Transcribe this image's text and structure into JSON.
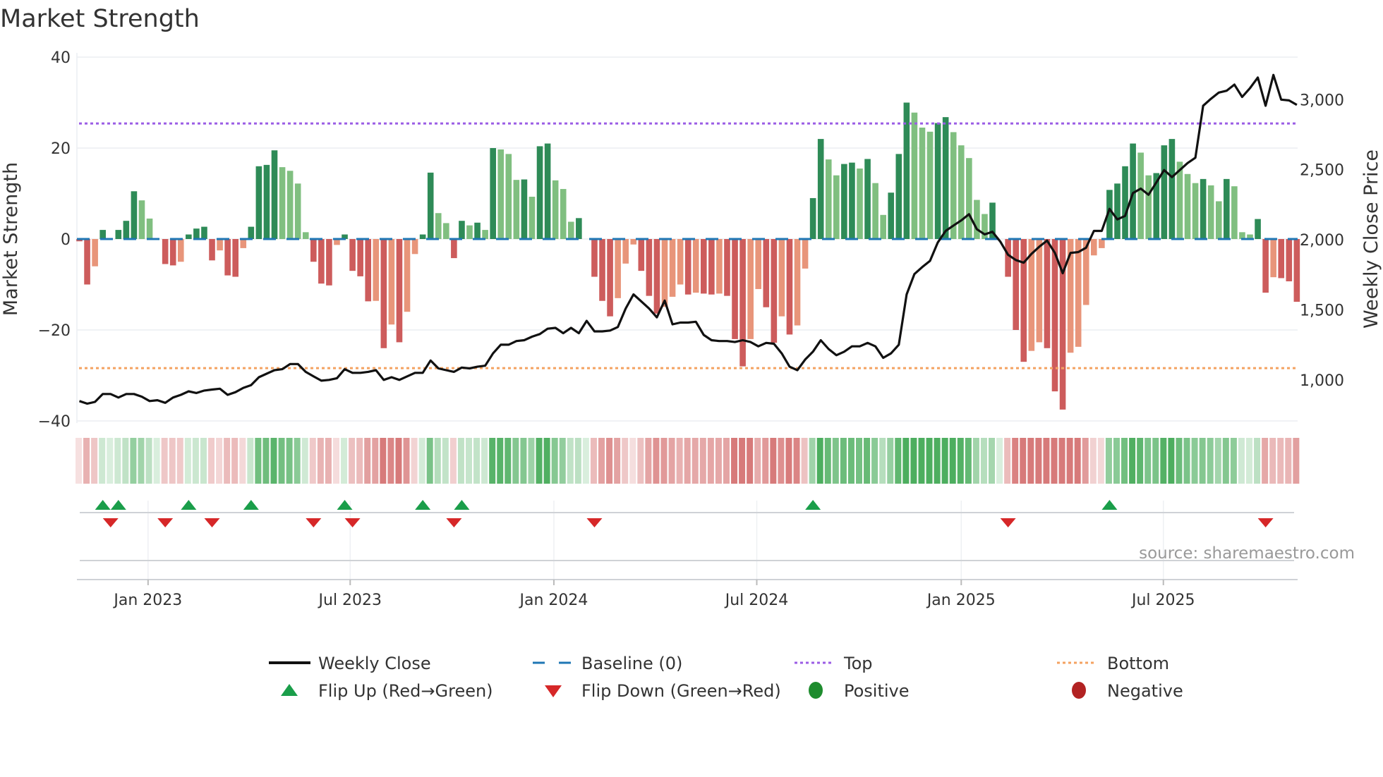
{
  "chart_data": {
    "type": "bar",
    "title": "Market Strength",
    "ylabel": "Market Strength",
    "y2label": "Weekly Close Price",
    "ylim": [
      -40,
      40
    ],
    "y_ticks": [
      40,
      20,
      0,
      -20,
      -40
    ],
    "y_tick_labels": [
      "40",
      "20",
      "0",
      "−20",
      "−40"
    ],
    "y2lim": [
      600,
      3300
    ],
    "y2_ticks": [
      3000,
      2500,
      2000,
      1500,
      1000
    ],
    "y2_tick_labels": [
      "3,000",
      "2,500",
      "2,000",
      "1,500",
      "1,000"
    ],
    "x_ticks": [
      {
        "label": "Jan 2023",
        "week": 8.8
      },
      {
        "label": "Jul 2023",
        "week": 34.7
      },
      {
        "label": "Jan 2024",
        "week": 60.8
      },
      {
        "label": "Jul 2024",
        "week": 86.8
      },
      {
        "label": "Jan 2025",
        "week": 113.0
      },
      {
        "label": "Jul 2025",
        "week": 138.9
      }
    ],
    "top_level": 25.4,
    "bottom_level": -28.4,
    "baseline": 0,
    "strength": [
      -0.5,
      -10,
      -6,
      2,
      0,
      2,
      4,
      10.5,
      8.5,
      4.5,
      0,
      -5.5,
      -5.8,
      -5,
      1,
      2.3,
      2.7,
      -4.7,
      -2.5,
      -8,
      -8.3,
      -2,
      2.7,
      16,
      16.3,
      19.5,
      15.8,
      15,
      12.2,
      1.5,
      -5,
      -9.8,
      -10.2,
      -1.3,
      1,
      -7,
      -8.2,
      -13.7,
      -13.6,
      -24,
      -18.8,
      -22.7,
      -16,
      -3.3,
      1,
      14.6,
      5.7,
      3.5,
      -4.2,
      4,
      3,
      3.6,
      2,
      20,
      19.7,
      18.7,
      13,
      13.1,
      9.3,
      20.4,
      21,
      12.9,
      11,
      3.8,
      4.6,
      0,
      -8.3,
      -13.6,
      -17,
      -13,
      -5.4,
      -1.2,
      -7,
      -12.5,
      -16.4,
      -14.9,
      -12.7,
      -10,
      -12.2,
      -11.8,
      -12,
      -12.2,
      -12,
      -12.5,
      -22,
      -28,
      -22,
      -11,
      -15,
      -22.8,
      -17,
      -21,
      -19,
      -6.5,
      9,
      22,
      17.5,
      14,
      16.5,
      16.8,
      15.5,
      17.6,
      12.3,
      5.3,
      10.2,
      18.7,
      30,
      27.8,
      24.5,
      23.6,
      25.5,
      26.8,
      23.5,
      20.6,
      17.8,
      8.6,
      5.5,
      8,
      0,
      -8.3,
      -20,
      -27,
      -24.6,
      -22.7,
      -24,
      -33.5,
      -37.5,
      -25,
      -23.7,
      -14.5,
      -3.6,
      -2,
      10.8,
      12.2,
      16,
      21,
      19,
      14,
      14.5,
      20.6,
      22,
      17,
      14.3,
      12.3,
      13.2,
      11.8,
      8.3,
      13.2,
      11.6,
      1.5,
      1,
      4.4,
      -11.8,
      -8.4,
      -8.6,
      -9.3,
      -13.8
    ],
    "weekly_close": [
      849,
      830,
      843,
      899,
      899,
      874,
      899,
      899,
      880,
      849,
      855,
      836,
      874,
      893,
      918,
      906,
      924,
      931,
      937,
      893,
      912,
      943,
      962,
      1019,
      1044,
      1069,
      1076,
      1113,
      1113,
      1057,
      1025,
      994,
      1000,
      1012,
      1076,
      1050,
      1050,
      1057,
      1069,
      1000,
      1019,
      1000,
      1025,
      1050,
      1050,
      1138,
      1082,
      1069,
      1057,
      1088,
      1082,
      1094,
      1101,
      1189,
      1251,
      1251,
      1277,
      1283,
      1308,
      1327,
      1365,
      1371,
      1333,
      1371,
      1333,
      1421,
      1346,
      1346,
      1352,
      1377,
      1509,
      1610,
      1560,
      1509,
      1446,
      1566,
      1396,
      1409,
      1409,
      1415,
      1321,
      1283,
      1277,
      1277,
      1270,
      1283,
      1270,
      1239,
      1264,
      1258,
      1189,
      1094,
      1069,
      1145,
      1201,
      1283,
      1220,
      1176,
      1201,
      1239,
      1239,
      1264,
      1239,
      1157,
      1189,
      1251,
      1610,
      1755,
      1805,
      1849,
      1981,
      2063,
      2101,
      2138,
      2182,
      2075,
      2038,
      2057,
      1987,
      1893,
      1855,
      1836,
      1899,
      1950,
      1994,
      1906,
      1761,
      1906,
      1912,
      1943,
      2063,
      2063,
      2220,
      2145,
      2170,
      2333,
      2365,
      2321,
      2409,
      2497,
      2447,
      2497,
      2547,
      2585,
      2956,
      3006,
      3050,
      3063,
      3107,
      3019,
      3082,
      3157,
      2956,
      3176,
      3000,
      2994,
      2962
    ],
    "flip_up_weeks": [
      3,
      5,
      14,
      22,
      34,
      44,
      49,
      94,
      132
    ],
    "flip_down_weeks": [
      4,
      11,
      17,
      30,
      35,
      48,
      66,
      119,
      152
    ],
    "legend": {
      "weekly_close": "Weekly Close",
      "baseline": "Baseline (0)",
      "top": "Top",
      "bottom": "Bottom",
      "flip_up": "Flip Up (Red→Green)",
      "flip_down": "Flip Down (Green→Red)",
      "positive": "Positive",
      "negative": "Negative"
    },
    "legend_placement": "bottom",
    "grid": true
  },
  "source": "source: sharemaestro.com",
  "colors": {
    "pos_strong": "#2e8b57",
    "pos_weak": "#80bf80",
    "neg_strong": "#cd5c5c",
    "neg_weak": "#e8957a",
    "baseline": "#1f77b4",
    "top": "#9b5de5",
    "bottom": "#f4a261",
    "flip_up": "#1a9e4a",
    "flip_down": "#d62728",
    "positive": "#1e8c2e",
    "negative": "#b22222",
    "close": "#111111"
  }
}
